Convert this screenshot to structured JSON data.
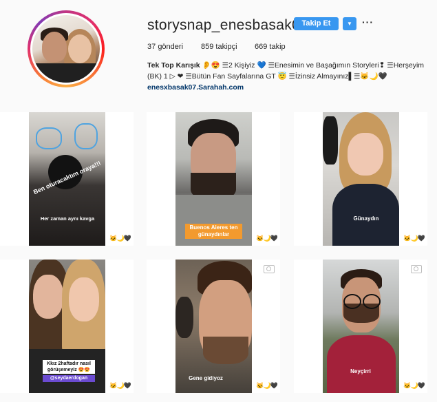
{
  "profile": {
    "username": "storysnap_enesbasak0",
    "follow_label": "Takip Et",
    "dropdown_icon": "chevron-down-icon",
    "more_icon": "ellipsis-icon",
    "stats": {
      "posts_count": "37",
      "posts_label": "gönderi",
      "followers_count": "859",
      "followers_label": "takipçi",
      "following_count": "669",
      "following_label": "takip"
    },
    "bio_name": "Tek Top Karışık",
    "bio_text": " 👂😍 ☰2 Kişiyiz 💙 ☰Enesimin ve Başağımın Storyleri❢ ☰Herşeyim (BK) 1 ▷ ❤ ☰Bütün Fan Sayfalarına GT 😇 ☰İzinsiz Almayınız▌☰🐱🌙🖤",
    "link": "enesxbasak07.Sarahah.com"
  },
  "posts": [
    {
      "caption": "Ben oturacaktım oraya!!!",
      "caption2": "Her zaman aynı kavga"
    },
    {
      "caption": "Buenos Aieres ten günaydınlar"
    },
    {
      "caption": "Günaydın"
    },
    {
      "caption": "Kkız 2haftadır nasıl görüşemeyiz 😍😍",
      "caption2": "@seydaerdogan"
    },
    {
      "caption": "Gene gidiyoz"
    },
    {
      "caption": "Neyçirri"
    }
  ],
  "tile_icons": "🐱🌙🖤",
  "colors": {
    "accent": "#3897f0",
    "link": "#003569",
    "background": "#fafafa"
  }
}
